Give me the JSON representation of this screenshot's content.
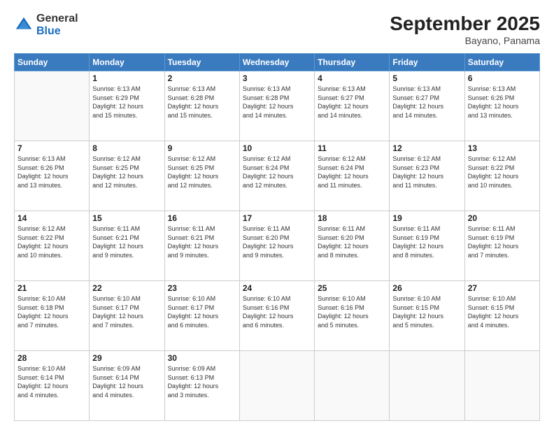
{
  "logo": {
    "general": "General",
    "blue": "Blue"
  },
  "title": "September 2025",
  "subtitle": "Bayano, Panama",
  "days": [
    "Sunday",
    "Monday",
    "Tuesday",
    "Wednesday",
    "Thursday",
    "Friday",
    "Saturday"
  ],
  "weeks": [
    [
      {
        "day": "",
        "info": ""
      },
      {
        "day": "1",
        "info": "Sunrise: 6:13 AM\nSunset: 6:29 PM\nDaylight: 12 hours\nand 15 minutes."
      },
      {
        "day": "2",
        "info": "Sunrise: 6:13 AM\nSunset: 6:28 PM\nDaylight: 12 hours\nand 15 minutes."
      },
      {
        "day": "3",
        "info": "Sunrise: 6:13 AM\nSunset: 6:28 PM\nDaylight: 12 hours\nand 14 minutes."
      },
      {
        "day": "4",
        "info": "Sunrise: 6:13 AM\nSunset: 6:27 PM\nDaylight: 12 hours\nand 14 minutes."
      },
      {
        "day": "5",
        "info": "Sunrise: 6:13 AM\nSunset: 6:27 PM\nDaylight: 12 hours\nand 14 minutes."
      },
      {
        "day": "6",
        "info": "Sunrise: 6:13 AM\nSunset: 6:26 PM\nDaylight: 12 hours\nand 13 minutes."
      }
    ],
    [
      {
        "day": "7",
        "info": "Sunrise: 6:13 AM\nSunset: 6:26 PM\nDaylight: 12 hours\nand 13 minutes."
      },
      {
        "day": "8",
        "info": "Sunrise: 6:12 AM\nSunset: 6:25 PM\nDaylight: 12 hours\nand 12 minutes."
      },
      {
        "day": "9",
        "info": "Sunrise: 6:12 AM\nSunset: 6:25 PM\nDaylight: 12 hours\nand 12 minutes."
      },
      {
        "day": "10",
        "info": "Sunrise: 6:12 AM\nSunset: 6:24 PM\nDaylight: 12 hours\nand 12 minutes."
      },
      {
        "day": "11",
        "info": "Sunrise: 6:12 AM\nSunset: 6:24 PM\nDaylight: 12 hours\nand 11 minutes."
      },
      {
        "day": "12",
        "info": "Sunrise: 6:12 AM\nSunset: 6:23 PM\nDaylight: 12 hours\nand 11 minutes."
      },
      {
        "day": "13",
        "info": "Sunrise: 6:12 AM\nSunset: 6:22 PM\nDaylight: 12 hours\nand 10 minutes."
      }
    ],
    [
      {
        "day": "14",
        "info": "Sunrise: 6:12 AM\nSunset: 6:22 PM\nDaylight: 12 hours\nand 10 minutes."
      },
      {
        "day": "15",
        "info": "Sunrise: 6:11 AM\nSunset: 6:21 PM\nDaylight: 12 hours\nand 9 minutes."
      },
      {
        "day": "16",
        "info": "Sunrise: 6:11 AM\nSunset: 6:21 PM\nDaylight: 12 hours\nand 9 minutes."
      },
      {
        "day": "17",
        "info": "Sunrise: 6:11 AM\nSunset: 6:20 PM\nDaylight: 12 hours\nand 9 minutes."
      },
      {
        "day": "18",
        "info": "Sunrise: 6:11 AM\nSunset: 6:20 PM\nDaylight: 12 hours\nand 8 minutes."
      },
      {
        "day": "19",
        "info": "Sunrise: 6:11 AM\nSunset: 6:19 PM\nDaylight: 12 hours\nand 8 minutes."
      },
      {
        "day": "20",
        "info": "Sunrise: 6:11 AM\nSunset: 6:19 PM\nDaylight: 12 hours\nand 7 minutes."
      }
    ],
    [
      {
        "day": "21",
        "info": "Sunrise: 6:10 AM\nSunset: 6:18 PM\nDaylight: 12 hours\nand 7 minutes."
      },
      {
        "day": "22",
        "info": "Sunrise: 6:10 AM\nSunset: 6:17 PM\nDaylight: 12 hours\nand 7 minutes."
      },
      {
        "day": "23",
        "info": "Sunrise: 6:10 AM\nSunset: 6:17 PM\nDaylight: 12 hours\nand 6 minutes."
      },
      {
        "day": "24",
        "info": "Sunrise: 6:10 AM\nSunset: 6:16 PM\nDaylight: 12 hours\nand 6 minutes."
      },
      {
        "day": "25",
        "info": "Sunrise: 6:10 AM\nSunset: 6:16 PM\nDaylight: 12 hours\nand 5 minutes."
      },
      {
        "day": "26",
        "info": "Sunrise: 6:10 AM\nSunset: 6:15 PM\nDaylight: 12 hours\nand 5 minutes."
      },
      {
        "day": "27",
        "info": "Sunrise: 6:10 AM\nSunset: 6:15 PM\nDaylight: 12 hours\nand 4 minutes."
      }
    ],
    [
      {
        "day": "28",
        "info": "Sunrise: 6:10 AM\nSunset: 6:14 PM\nDaylight: 12 hours\nand 4 minutes."
      },
      {
        "day": "29",
        "info": "Sunrise: 6:09 AM\nSunset: 6:14 PM\nDaylight: 12 hours\nand 4 minutes."
      },
      {
        "day": "30",
        "info": "Sunrise: 6:09 AM\nSunset: 6:13 PM\nDaylight: 12 hours\nand 3 minutes."
      },
      {
        "day": "",
        "info": ""
      },
      {
        "day": "",
        "info": ""
      },
      {
        "day": "",
        "info": ""
      },
      {
        "day": "",
        "info": ""
      }
    ]
  ]
}
